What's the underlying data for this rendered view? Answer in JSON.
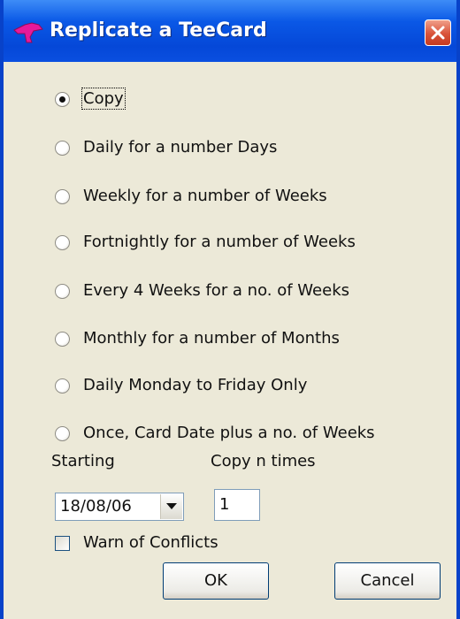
{
  "window": {
    "title": "Replicate a TeeCard",
    "icon": "teecard-app-icon",
    "close_icon": "close-icon"
  },
  "options": [
    {
      "label": "Copy",
      "selected": true
    },
    {
      "label": "Daily for a number Days",
      "selected": false
    },
    {
      "label": "Weekly for a number of Weeks",
      "selected": false
    },
    {
      "label": "Fortnightly for a number of Weeks",
      "selected": false
    },
    {
      "label": "Every 4 Weeks for a no. of Weeks",
      "selected": false
    },
    {
      "label": "Monthly for a number of Months",
      "selected": false
    },
    {
      "label": "Daily Monday to Friday Only",
      "selected": false
    },
    {
      "label": "Once, Card Date plus a no. of Weeks",
      "selected": false
    }
  ],
  "starting": {
    "label": "Starting",
    "value": "18/08/06"
  },
  "copy_times": {
    "label": "Copy n times",
    "value": "1"
  },
  "warn": {
    "label": "Warn of Conflicts",
    "checked": false
  },
  "buttons": {
    "ok": "OK",
    "cancel": "Cancel"
  },
  "colors": {
    "titlebar": "#0a58e6",
    "window_bg": "#ece9d8",
    "close_button": "#d9533a"
  }
}
